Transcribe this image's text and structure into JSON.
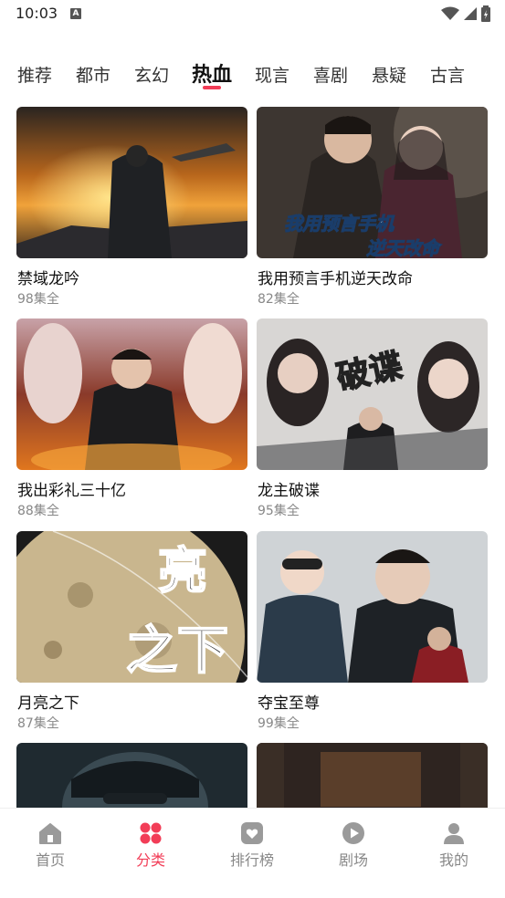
{
  "status_bar": {
    "time": "10:03",
    "a_badge": "A"
  },
  "tabs": [
    {
      "label": "推荐"
    },
    {
      "label": "都市"
    },
    {
      "label": "玄幻"
    },
    {
      "label": "热血"
    },
    {
      "label": "现言"
    },
    {
      "label": "喜剧"
    },
    {
      "label": "悬疑"
    },
    {
      "label": "古言"
    }
  ],
  "active_tab_index": 3,
  "accent_color": "#f23d57",
  "dramas": [
    {
      "title": "禁域龙吟",
      "episodes": "98集全"
    },
    {
      "title": "我用预言手机逆天改命",
      "episodes": "82集全",
      "poster_text_1": "我用预言手机",
      "poster_text_2": "逆天改命"
    },
    {
      "title": "我出彩礼三十亿",
      "episodes": "88集全"
    },
    {
      "title": "龙主破谍",
      "episodes": "95集全",
      "poster_text": "破谍"
    },
    {
      "title": "月亮之下",
      "episodes": "87集全",
      "poster_text_1": "亮",
      "poster_text_2": "之下"
    },
    {
      "title": "夺宝至尊",
      "episodes": "99集全"
    }
  ],
  "bottom_nav": [
    {
      "label": "首页",
      "icon": "home-icon"
    },
    {
      "label": "分类",
      "icon": "category-icon"
    },
    {
      "label": "排行榜",
      "icon": "ranking-icon"
    },
    {
      "label": "剧场",
      "icon": "play-icon"
    },
    {
      "label": "我的",
      "icon": "user-icon"
    }
  ],
  "active_nav_index": 1
}
